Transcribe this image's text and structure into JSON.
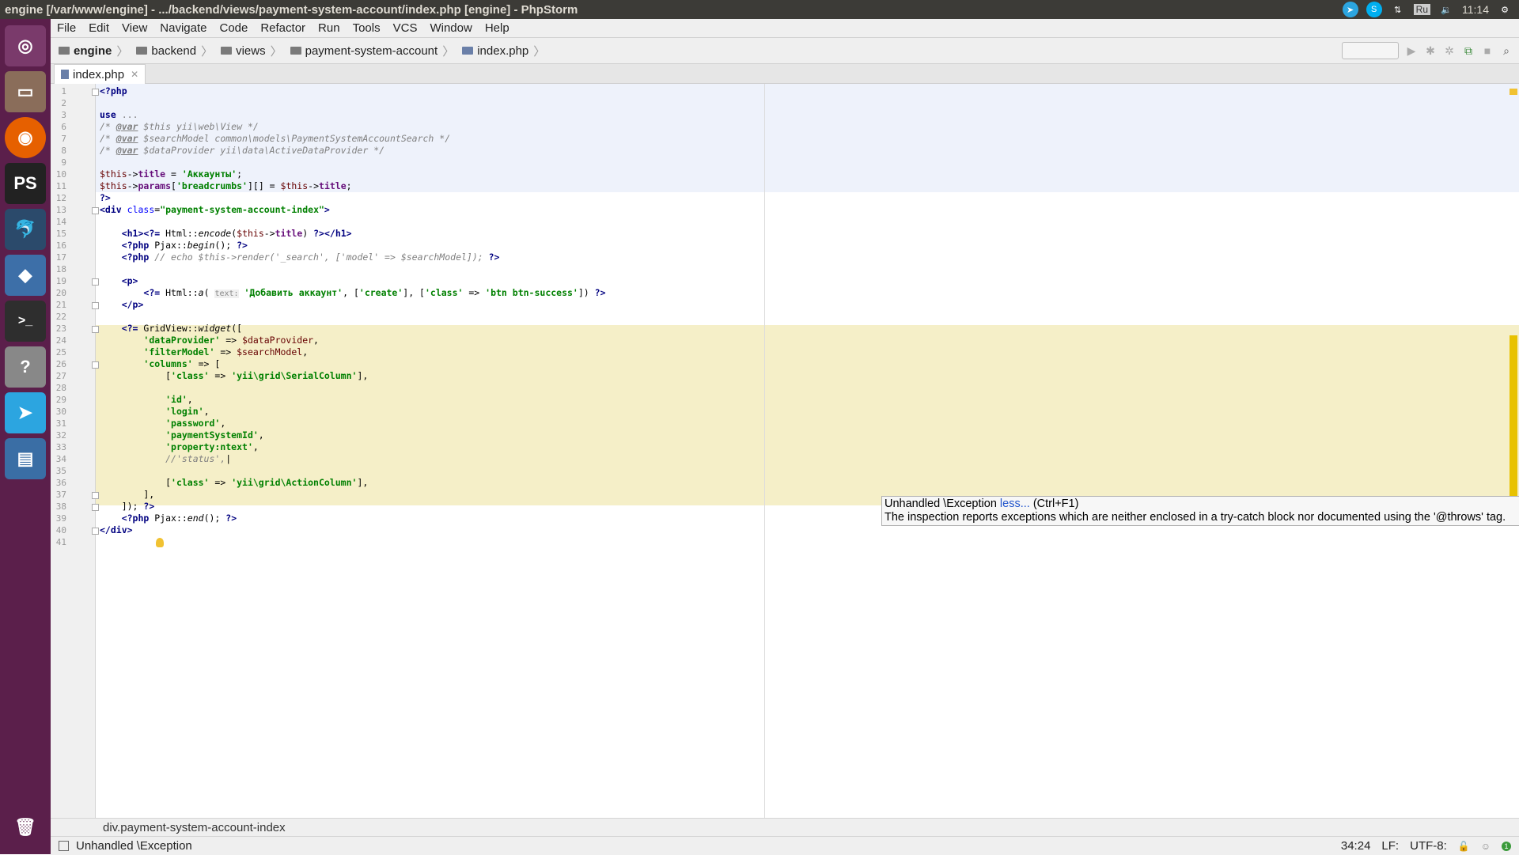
{
  "window": {
    "title": "engine [/var/www/engine] - .../backend/views/payment-system-account/index.php [engine] - PhpStorm"
  },
  "tray": {
    "keyboard": "Ru",
    "time": "11:14"
  },
  "menu": [
    "File",
    "Edit",
    "View",
    "Navigate",
    "Code",
    "Refactor",
    "Run",
    "Tools",
    "VCS",
    "Window",
    "Help"
  ],
  "breadcrumbs": [
    "engine",
    "backend",
    "views",
    "payment-system-account",
    "index.php"
  ],
  "tab": {
    "label": "index.php"
  },
  "tooltip": {
    "title": "Unhandled \\Exception",
    "link": "less...",
    "shortcut": "(Ctrl+F1)",
    "body": "The inspection reports exceptions which are neither enclosed in a try-catch block nor documented using the '@throws' tag."
  },
  "structure_path": "div.payment-system-account-index",
  "status": {
    "message": "Unhandled \\Exception",
    "position": "34:24",
    "line_sep": "LF:",
    "encoding": "UTF-8:"
  },
  "colors": {
    "launcher": "#5b1f4b",
    "highlight_yellow": "#f5efc8",
    "highlight_blue": "#eef2fb",
    "accent": "#f1c232"
  },
  "icons": [
    "ubuntu-logo-icon",
    "files-icon",
    "firefox-icon",
    "phpstorm-icon",
    "mysql-workbench-icon",
    "cube-icon",
    "terminal-icon",
    "help-icon",
    "telegram-icon",
    "screenshot-icon",
    "trash-icon"
  ]
}
